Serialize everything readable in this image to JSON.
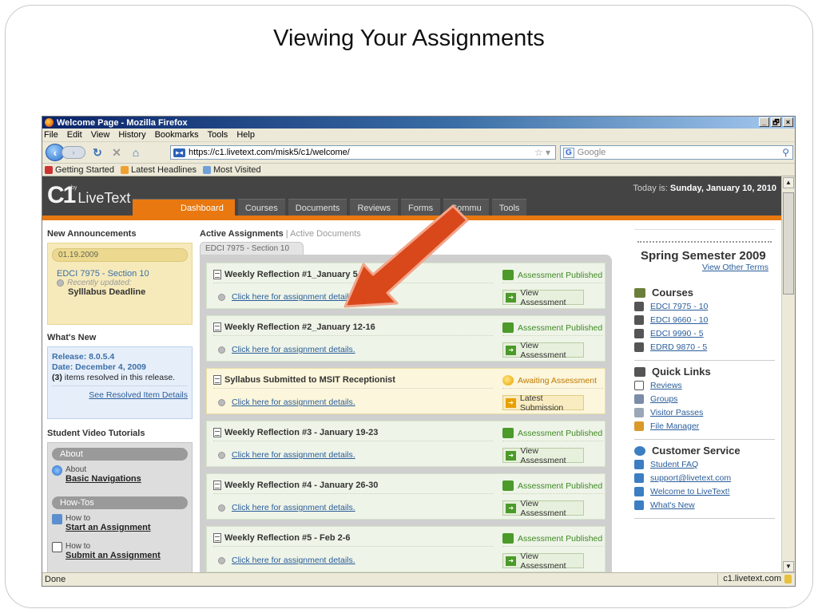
{
  "slide": {
    "title": "Viewing Your Assignments"
  },
  "window": {
    "title": "Welcome Page - Mozilla Firefox",
    "min": "_",
    "max": "🗗",
    "close": "×"
  },
  "menu": [
    "File",
    "Edit",
    "View",
    "History",
    "Bookmarks",
    "Tools",
    "Help"
  ],
  "nav": {
    "url": "https://c1.livetext.com/misk5/c1/welcome/",
    "search_placeholder": "Google",
    "search_engine": "G"
  },
  "bookmarks": [
    "Getting Started",
    "Latest Headlines",
    "Most Visited"
  ],
  "livetext": {
    "logo": "C1",
    "by": "by",
    "brand": "LiveText",
    "today_label": "Today is:",
    "today_date": "Sunday, January 10, 2010",
    "tabs": [
      "Dashboard",
      "Courses",
      "Documents",
      "Reviews",
      "Forms",
      "Commu",
      "Tools"
    ]
  },
  "announcements": {
    "heading": "New Announcements",
    "date": "01.19.2009",
    "course": "EDCI 7975 - Section 10",
    "updated": "Recently updated:",
    "title": "Sylllabus Deadline"
  },
  "whats_new": {
    "heading": "What's New",
    "release": "Release: 8.0.5.4",
    "date": "Date: December 4, 2009",
    "count": "(3)",
    "items_text": " items resolved in this release.",
    "link": "See Resolved Item Details"
  },
  "tutorials": {
    "heading": "Student Video Tutorials",
    "about_label": "About",
    "about_items": [
      {
        "small": "About",
        "big": "Basic Navigations"
      }
    ],
    "howto_label": "How-Tos",
    "howto_items": [
      {
        "small": "How to",
        "big": "Start an Assignment"
      },
      {
        "small": "How to",
        "big": "Submit an Assignment"
      }
    ]
  },
  "assignments": {
    "heading": "Active Assignments",
    "sep": " | ",
    "alt": "Active Documents",
    "course_tab": "EDCI 7975 - Section 10",
    "items": [
      {
        "title": "Weekly Reflection #1_January 5-9",
        "detail": "Click here for assignment details.",
        "status": "Assessment Published",
        "action": "View Assessment"
      },
      {
        "title": "Weekly Reflection #2_January 12-16",
        "detail": "Click here for assignment details.",
        "status": "Assessment Published",
        "action": "View Assessment"
      },
      {
        "title": "Syllabus Submitted to MSIT Receptionist",
        "detail": "Click here for assignment details.",
        "status": "Awaiting Assessment",
        "action": "Latest Submission"
      },
      {
        "title": "Weekly Reflection #3 - January 19-23",
        "detail": "Click here for assignment details.",
        "status": "Assessment Published",
        "action": "View Assessment"
      },
      {
        "title": "Weekly Reflection #4 - January 26-30",
        "detail": "Click here for assignment details.",
        "status": "Assessment Published",
        "action": "View Assessment"
      },
      {
        "title": "Weekly Reflection #5 - Feb 2-6",
        "detail": "Click here for assignment details.",
        "status": "Assessment Published",
        "action": "View Assessment"
      }
    ]
  },
  "semester": {
    "title": "Spring Semester 2009",
    "link": "View Other Terms"
  },
  "courses": {
    "heading": "Courses",
    "items": [
      "EDCI 7975 - 10",
      "EDCI 9660 - 10",
      "EDCI 9990 - 5",
      "EDRD 9870 - 5"
    ]
  },
  "quick_links": {
    "heading": "Quick Links",
    "items": [
      "Reviews",
      "Groups",
      "Visitor Passes",
      "File Manager"
    ]
  },
  "customer_service": {
    "heading": "Customer Service",
    "items": [
      "Student FAQ",
      "support@livetext.com",
      "Welcome to LiveText!",
      "What's New"
    ]
  },
  "status": {
    "left": "Done",
    "right": "c1.livetext.com"
  },
  "colors": {
    "accent": "#e8780f",
    "header": "#444444",
    "arrow": "#d9481a",
    "published": "#3f8a24",
    "awaiting": "#c07a00",
    "link": "#2a5d9a"
  }
}
